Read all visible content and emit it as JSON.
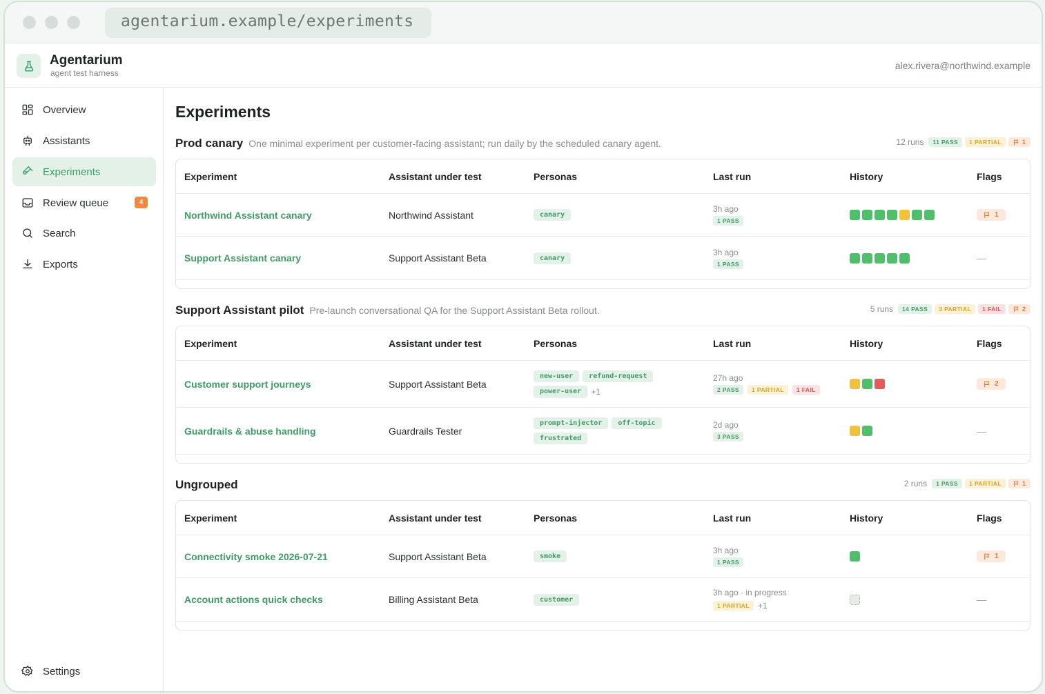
{
  "browser": {
    "url": "agentarium.example/experiments"
  },
  "app": {
    "name": "Agentarium",
    "subtitle": "agent test harness",
    "user": "alex.rivera@northwind.example"
  },
  "sidebar": {
    "items": [
      {
        "label": "Overview",
        "icon": "grid-icon"
      },
      {
        "label": "Assistants",
        "icon": "robot-icon"
      },
      {
        "label": "Experiments",
        "icon": "flask-icon",
        "active": true
      },
      {
        "label": "Review queue",
        "icon": "inbox-icon",
        "badge": "4"
      },
      {
        "label": "Search",
        "icon": "search-icon"
      },
      {
        "label": "Exports",
        "icon": "download-icon"
      }
    ],
    "settings": "Settings"
  },
  "page": {
    "title": "Experiments"
  },
  "columns": [
    "Experiment",
    "Assistant under test",
    "Personas",
    "Last run",
    "History",
    "Flags"
  ],
  "groups": [
    {
      "name": "Prod canary",
      "description": "One minimal experiment per customer-facing assistant; run daily by the scheduled canary agent.",
      "runs": "12 runs",
      "pass": "11 PASS",
      "partial": "1 PARTIAL",
      "flags": "1",
      "rows": [
        {
          "name": "Northwind Assistant canary",
          "assistant": "Northwind Assistant",
          "personas": [
            "canary"
          ],
          "ago": "3h ago",
          "result": "1 PASS",
          "history": [
            "p",
            "p",
            "p",
            "p",
            "y",
            "p",
            "p"
          ],
          "flags": "1"
        },
        {
          "name": "Support Assistant canary",
          "assistant": "Support Assistant Beta",
          "personas": [
            "canary"
          ],
          "ago": "3h ago",
          "result": "1 PASS",
          "history": [
            "p",
            "p",
            "p",
            "p",
            "p"
          ],
          "flags": "—"
        }
      ]
    },
    {
      "name": "Support Assistant pilot",
      "description": "Pre-launch conversational QA for the Support Assistant Beta rollout.",
      "runs": "5 runs",
      "pass": "14 PASS",
      "partial": "3 PARTIAL",
      "fail": "1 FAIL",
      "flags": "2",
      "rows": [
        {
          "name": "Customer support journeys",
          "assistant": "Support Assistant Beta",
          "personas": [
            "new-user",
            "refund-request",
            "power-user"
          ],
          "personas_more": "+1",
          "ago": "27h ago",
          "result": "2 PASS",
          "result_partial": "1 PARTIAL",
          "result_fail": "1 FAIL",
          "history": [
            "y",
            "p",
            "r"
          ],
          "flags": "2"
        },
        {
          "name": "Guardrails & abuse handling",
          "assistant": "Guardrails Tester",
          "personas": [
            "prompt-injector",
            "off-topic",
            "frustrated"
          ],
          "ago": "2d ago",
          "result": "3 PASS",
          "history": [
            "y",
            "p"
          ],
          "flags": "—"
        }
      ]
    },
    {
      "name": "Ungrouped",
      "runs": "2 runs",
      "pass": "1 PASS",
      "partial": "1 PARTIAL",
      "flags": "1",
      "rows": [
        {
          "name": "Connectivity smoke 2026-07-21",
          "assistant": "Support Assistant Beta",
          "personas": [
            "smoke"
          ],
          "ago": "3h ago",
          "result": "1 PASS",
          "history": [
            "p"
          ],
          "flags": "1"
        },
        {
          "name": "Account actions quick checks",
          "assistant": "Billing Assistant Beta",
          "personas": [
            "customer"
          ],
          "ago": "3h ago · in progress",
          "result_partial": "1 PARTIAL",
          "result_more": "+1",
          "history": [
            "g"
          ],
          "flags": "—"
        }
      ]
    }
  ],
  "colors": {
    "accent": "#3f9a66",
    "pass": "#4fbf6c",
    "partial": "#f0c23c",
    "fail": "#e45b5b",
    "flag": "#e07a3c"
  }
}
